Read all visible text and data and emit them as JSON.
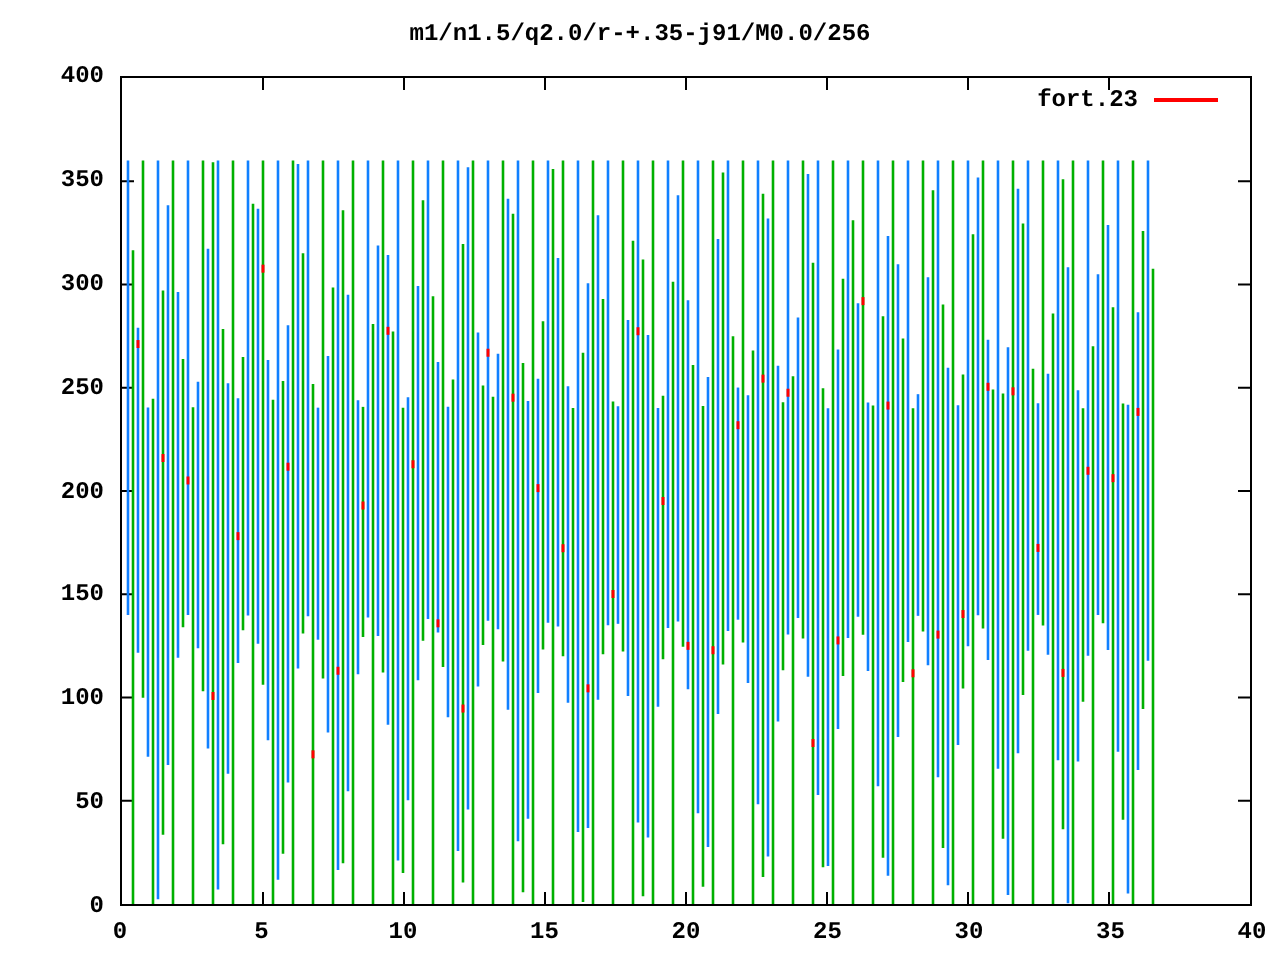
{
  "title": "m1/n1.5/q2.0/r-+.35-j91/M0.0/256",
  "legend": {
    "label": "fort.23",
    "color": "#ff0000"
  },
  "y_ticks": [
    "400",
    "350",
    "300",
    "250",
    "200",
    "150",
    "100",
    "50",
    "0"
  ],
  "x_ticks": [
    "0",
    "5",
    "10",
    "15",
    "20",
    "25",
    "30",
    "35",
    "40"
  ]
}
